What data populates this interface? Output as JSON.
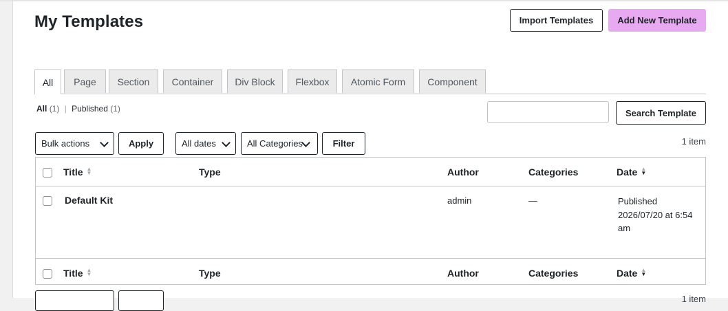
{
  "page": {
    "title": "My Templates",
    "import_button": "Import Templates",
    "add_button": "Add New Template"
  },
  "tabs": [
    {
      "label": "All",
      "active": true
    },
    {
      "label": "Page"
    },
    {
      "label": "Section"
    },
    {
      "label": "Container"
    },
    {
      "label": "Div Block"
    },
    {
      "label": "Flexbox"
    },
    {
      "label": "Atomic Form"
    },
    {
      "label": "Component"
    }
  ],
  "views": {
    "all_label": "All",
    "all_count": "(1)",
    "separator": "|",
    "published_label": "Published",
    "published_count": "(1)"
  },
  "search": {
    "value": "",
    "button_label": "Search Template"
  },
  "filters": {
    "bulk_actions": "Bulk actions",
    "apply_label": "Apply",
    "dates": "All dates",
    "categories": "All Categories",
    "filter_label": "Filter",
    "item_count": "1 item"
  },
  "table": {
    "columns": {
      "title": "Title",
      "type": "Type",
      "author": "Author",
      "categories": "Categories",
      "date": "Date"
    },
    "sort_icons": {
      "up": "▲",
      "down": "▼"
    },
    "rows": [
      {
        "title": "Default Kit",
        "type": "",
        "author": "admin",
        "categories": "—",
        "date_status": "Published",
        "date_value": "2026/07/20 at 6:54 am"
      }
    ]
  },
  "colors": {
    "accent": "#e7a9f0",
    "border": "#c3c4c7",
    "text": "#1d2327"
  }
}
